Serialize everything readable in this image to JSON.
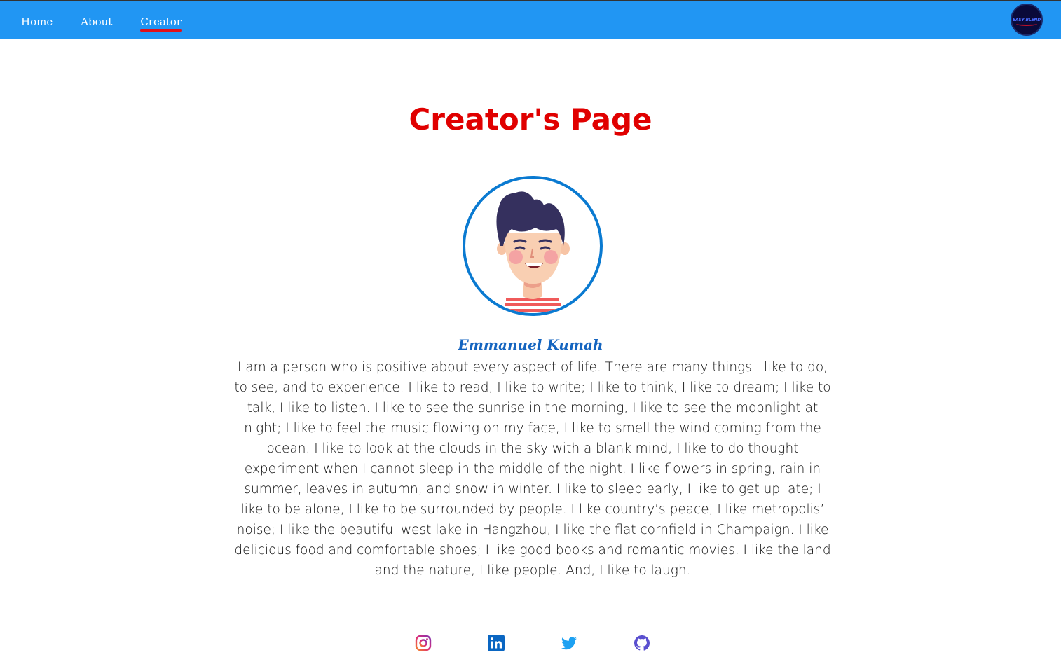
{
  "nav": {
    "items": [
      {
        "label": "Home",
        "active": false
      },
      {
        "label": "About",
        "active": false
      },
      {
        "label": "Creator",
        "active": true
      }
    ],
    "logo_text": "EASY BLEND"
  },
  "main": {
    "title": "Creator's Page",
    "creator_name": "Emmanuel Kumah",
    "bio": "I am a person who is positive about every aspect of life. There are many things I like to do, to see, and to experience. I like to read, I like to write; I like to think, I like to dream; I like to talk, I like to listen. I like to see the sunrise in the morning, I like to see the moonlight at night; I like to feel the music flowing on my face, I like to smell the wind coming from the ocean. I like to look at the clouds in the sky with a blank mind, I like to do thought experiment when I cannot sleep in the middle of the night. I like flowers in spring, rain in summer, leaves in autumn, and snow in winter. I like to sleep early, I like to get up late; I like to be alone, I like to be surrounded by people. I like country’s peace, I like metropolis’ noise; I like the beautiful west lake in Hangzhou, I like the flat cornfield in Champaign. I like delicious food and comfortable shoes; I like good books and romantic movies. I like the land and the nature, I like people. And, I like to laugh."
  },
  "socials": [
    {
      "icon": "instagram-icon",
      "color": "#e1306c"
    },
    {
      "icon": "linkedin-icon",
      "color": "#0a66c2"
    },
    {
      "icon": "twitter-icon",
      "color": "#1da1f2"
    },
    {
      "icon": "github-icon",
      "color": "#5a4fcf"
    }
  ],
  "colors": {
    "navbar": "#2196f3",
    "title": "#e00000",
    "name": "#1565c0",
    "avatar_border": "#0a7ad1",
    "active_underline": "#e0101a"
  }
}
